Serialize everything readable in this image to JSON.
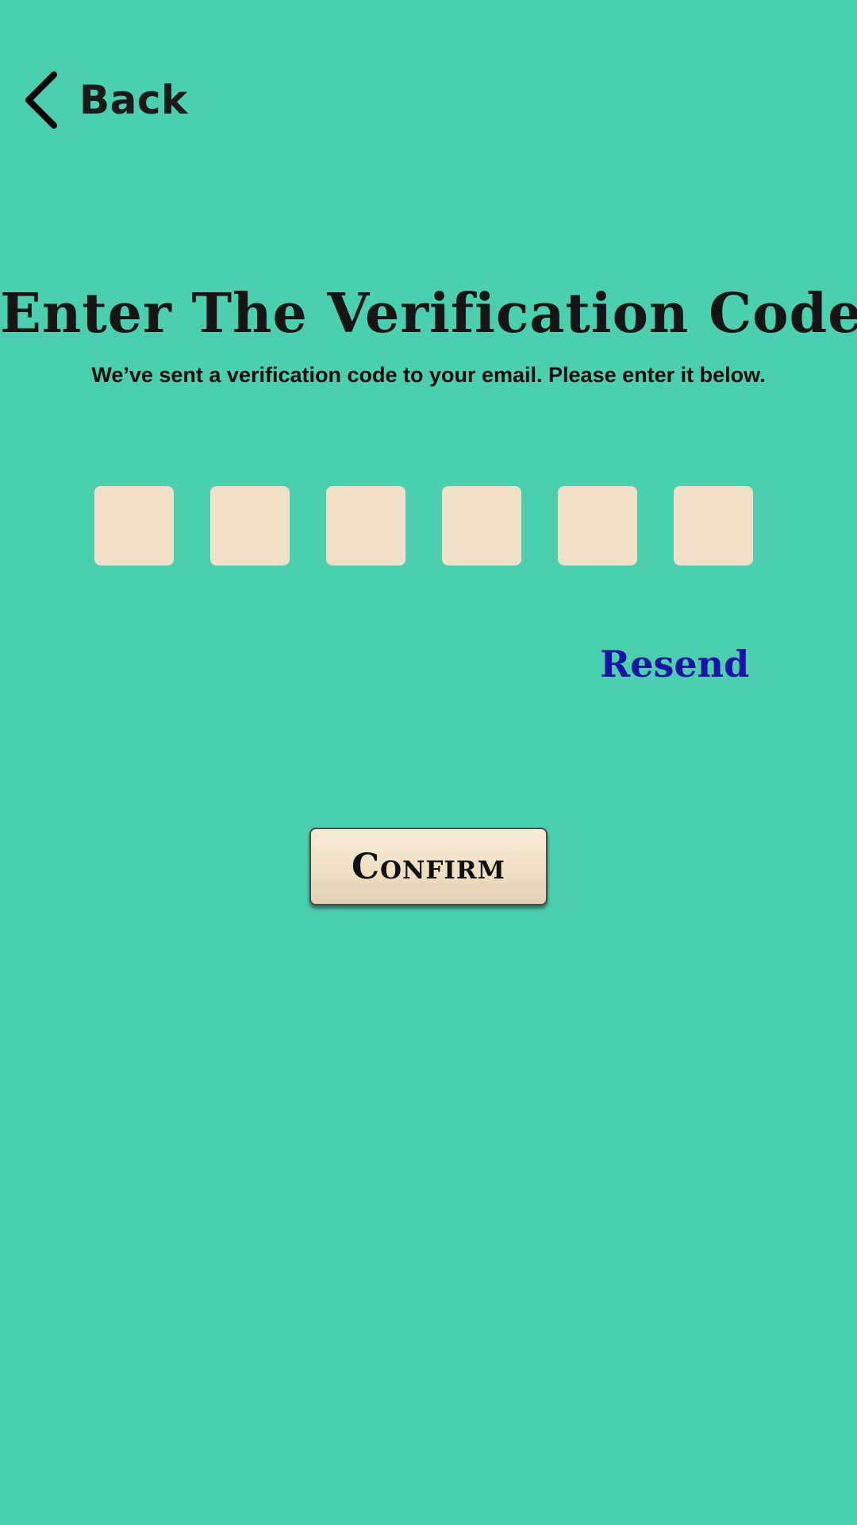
{
  "header": {
    "back_label": "Back",
    "back_icon": "chevron-left-icon"
  },
  "title": "Enter The Verification Code",
  "subtitle": "We’ve sent a verification code to your email. Please enter it below.",
  "code_inputs": [
    {
      "value": ""
    },
    {
      "value": ""
    },
    {
      "value": ""
    },
    {
      "value": ""
    },
    {
      "value": ""
    },
    {
      "value": ""
    }
  ],
  "resend_label": "Resend",
  "confirm_label": "Confirm",
  "colors": {
    "background": "#4ccfae",
    "input_fill": "#f1e1c9",
    "resend_link": "#1a14a6",
    "text_dark": "#151515"
  }
}
